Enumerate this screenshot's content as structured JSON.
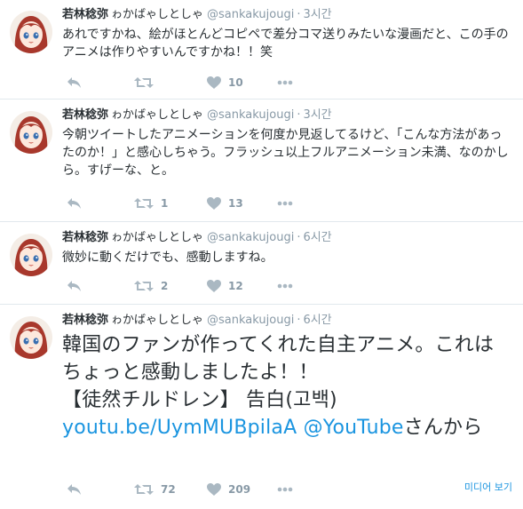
{
  "tweets": [
    {
      "name": "若林稔弥",
      "furigana": "ゎかばゃしとしゃ",
      "handle": "@sankakujougi",
      "time": "3시간",
      "text": "あれですかね、絵がほとんどコピペで差分コマ送りみたいな漫画だと、この手のアニメは作りやすいんですかね！！笑",
      "retweets": "",
      "likes": "10"
    },
    {
      "name": "若林稔弥",
      "furigana": "ゎかばゃしとしゃ",
      "handle": "@sankakujougi",
      "time": "3시간",
      "text": "今朝ツイートしたアニメーションを何度か見返してるけど、「こんな方法があったのか！」と感心しちゃう。フラッシュ以上フルアニメーション未満、なのかしら。すげーな、と。",
      "retweets": "1",
      "likes": "13"
    },
    {
      "name": "若林稔弥",
      "furigana": "ゎかばゃしとしゃ",
      "handle": "@sankakujougi",
      "time": "6시간",
      "text": "微妙に動くだけでも、感動しますね。",
      "retweets": "2",
      "likes": "12"
    },
    {
      "name": "若林稔弥",
      "furigana": "ゎかばゃしとしゃ",
      "handle": "@sankakujougi",
      "time": "6시간",
      "text_line1": "韓国のファンが作ってくれた自主アニメ。これはちょっと感動しましたよ！！",
      "text_line2": "【徒然チルドレン】 告白(고백)",
      "link_url": "youtu.be/UymMUBpilaA",
      "link_mention": "@YouTube",
      "text_tail": "さんから",
      "retweets": "72",
      "likes": "209",
      "media_label": "미디어 보기"
    }
  ],
  "colors": {
    "text": "#292f33",
    "muted": "#8899a6",
    "link": "#1b95e0",
    "divider": "#e1e8ed"
  },
  "icons": {
    "reply": "reply-icon",
    "retweet": "retweet-icon",
    "like": "heart-icon",
    "more": "more-icon"
  }
}
